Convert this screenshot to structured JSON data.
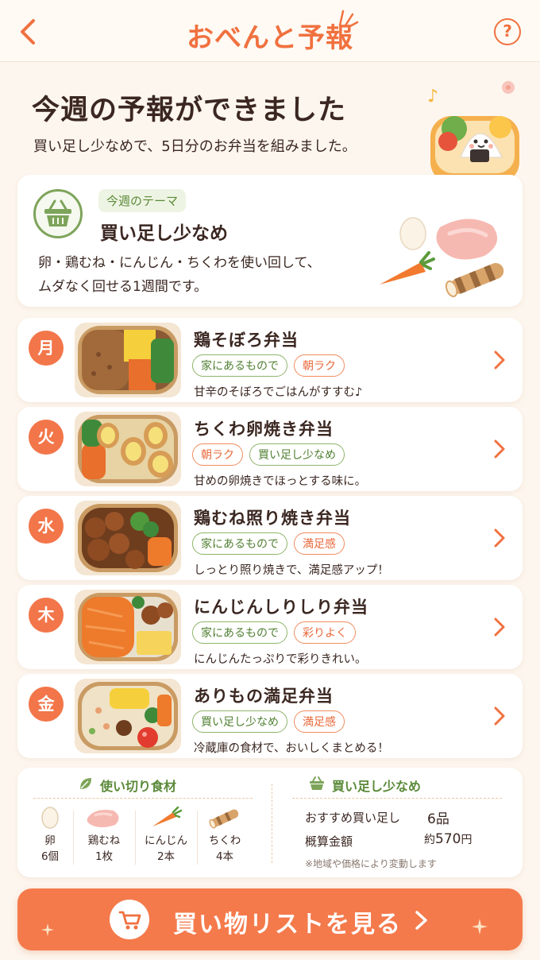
{
  "header": {
    "title": "おべんと予報",
    "help_label": "?"
  },
  "hero": {
    "headline": "今週の予報ができました",
    "subline": "買い足し少なめで、5日分のお弁当を組みました。"
  },
  "theme": {
    "chip": "今週のテーマ",
    "title": "買い足し少なめ",
    "desc_line1": "卵・鶏むね・にんじん・ちくわを使い回して、",
    "desc_line2": "ムダなく回せる1週間です。"
  },
  "days": [
    {
      "day": "月",
      "title": "鶏そぼろ弁当",
      "tags": [
        {
          "text": "家にあるもので",
          "tone": "green"
        },
        {
          "text": "朝ラク",
          "tone": "orange"
        }
      ],
      "desc": "甘辛のそぼろでごはんがすすむ♪"
    },
    {
      "day": "火",
      "title": "ちくわ卵焼き弁当",
      "tags": [
        {
          "text": "朝ラク",
          "tone": "orange"
        },
        {
          "text": "買い足し少なめ",
          "tone": "green"
        }
      ],
      "desc": "甘めの卵焼きでほっとする味に。"
    },
    {
      "day": "水",
      "title": "鶏むね照り焼き弁当",
      "tags": [
        {
          "text": "家にあるもので",
          "tone": "green"
        },
        {
          "text": "満足感",
          "tone": "orange"
        }
      ],
      "desc": "しっとり照り焼きで、満足感アップ！"
    },
    {
      "day": "木",
      "title": "にんじんしりしり弁当",
      "tags": [
        {
          "text": "家にあるもので",
          "tone": "green"
        },
        {
          "text": "彩りよく",
          "tone": "orange"
        }
      ],
      "desc": "にんじんたっぷりで彩りきれい。"
    },
    {
      "day": "金",
      "title": "ありもの満足弁当",
      "tags": [
        {
          "text": "買い足し少なめ",
          "tone": "green"
        },
        {
          "text": "満足感",
          "tone": "orange"
        }
      ],
      "desc": "冷蔵庫の食材で、おいしくまとめる！"
    }
  ],
  "summary": {
    "ingredients_heading": "使い切り食材",
    "ingredients": [
      {
        "name": "卵",
        "qty": "6個"
      },
      {
        "name": "鶏むね",
        "qty": "1枚"
      },
      {
        "name": "にんじん",
        "qty": "2本"
      },
      {
        "name": "ちくわ",
        "qty": "4本"
      }
    ],
    "buy_heading": "買い足し少なめ",
    "buy_count_label": "おすすめ買い足し",
    "buy_count_value": "6品",
    "cost_label": "概算金額",
    "cost_prefix": "約",
    "cost_value": "570",
    "cost_unit": "円",
    "note": "※地域や価格により変動します"
  },
  "cta": {
    "label": "買い物リストを見る"
  },
  "colors": {
    "accent": "#f0713f",
    "green": "#7da45a",
    "background": "#fdf6ee"
  }
}
